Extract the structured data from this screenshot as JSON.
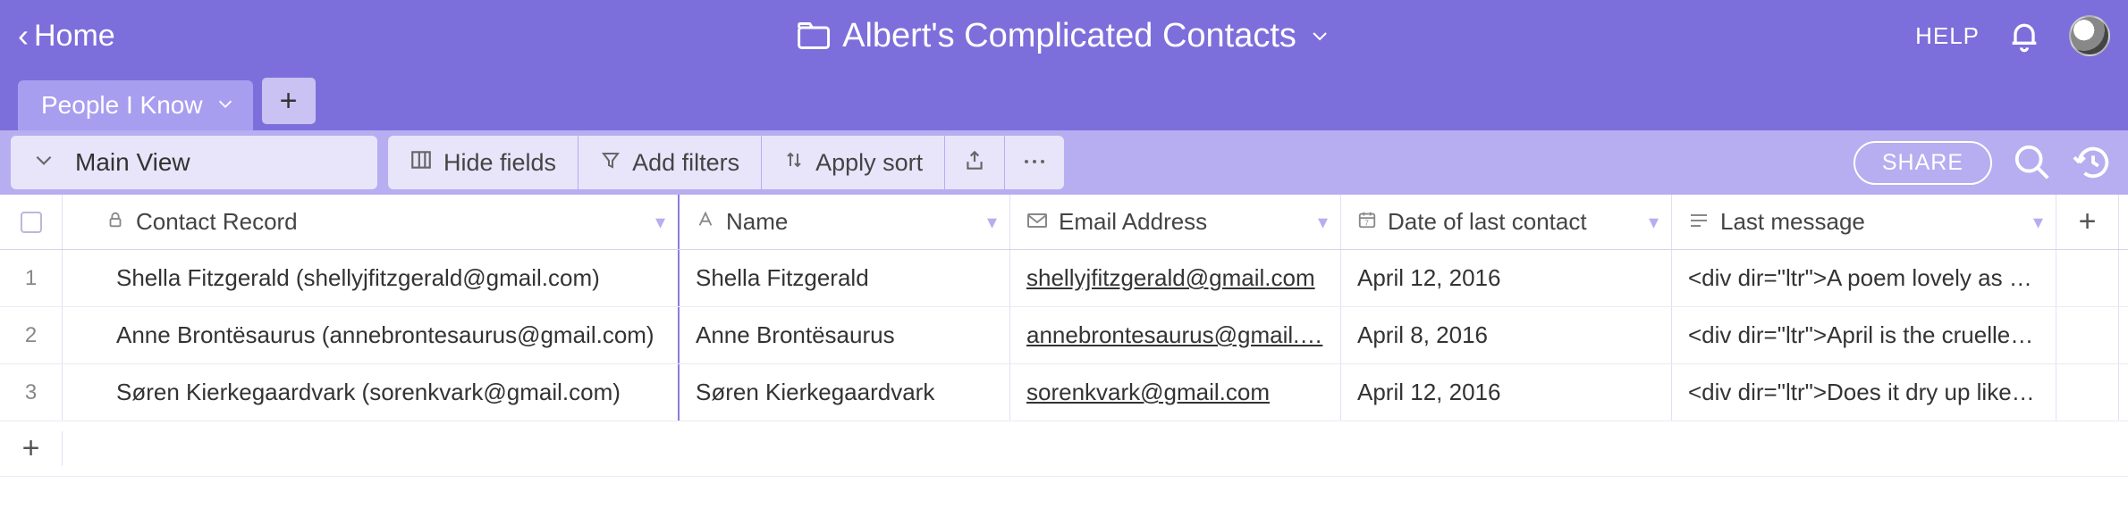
{
  "header": {
    "home_label": "Home",
    "base_name": "Albert's Complicated Contacts",
    "help_label": "HELP"
  },
  "tabs": {
    "active_label": "People I Know"
  },
  "toolbar": {
    "view_label": "Main View",
    "hide_fields_label": "Hide fields",
    "add_filters_label": "Add filters",
    "apply_sort_label": "Apply sort",
    "share_label": "SHARE"
  },
  "columns": [
    {
      "label": "Contact Record"
    },
    {
      "label": "Name"
    },
    {
      "label": "Email Address"
    },
    {
      "label": "Date of last contact"
    },
    {
      "label": "Last message"
    }
  ],
  "rows": [
    {
      "idx": "1",
      "record": "Shella Fitzgerald (shellyjfitzgerald@gmail.com)",
      "name": "Shella Fitzgerald",
      "email": "shellyjfitzgerald@gmail.com",
      "date": "April 12, 2016",
      "msg": "<div dir=\"ltr\">A poem lovely as …"
    },
    {
      "idx": "2",
      "record": "Anne Brontësaurus (annebrontesaurus@gmail.com)",
      "name": "Anne Brontësaurus",
      "email": "annebrontesaurus@gmail.…",
      "date": "April 8, 2016",
      "msg": "<div dir=\"ltr\">April is the cruelle…"
    },
    {
      "idx": "3",
      "record": "Søren Kierkegaardvark (sorenkvark@gmail.com)",
      "name": "Søren Kierkegaardvark",
      "email": "sorenkvark@gmail.com",
      "date": "April 12, 2016",
      "msg": "<div dir=\"ltr\">Does it dry up like…"
    }
  ]
}
